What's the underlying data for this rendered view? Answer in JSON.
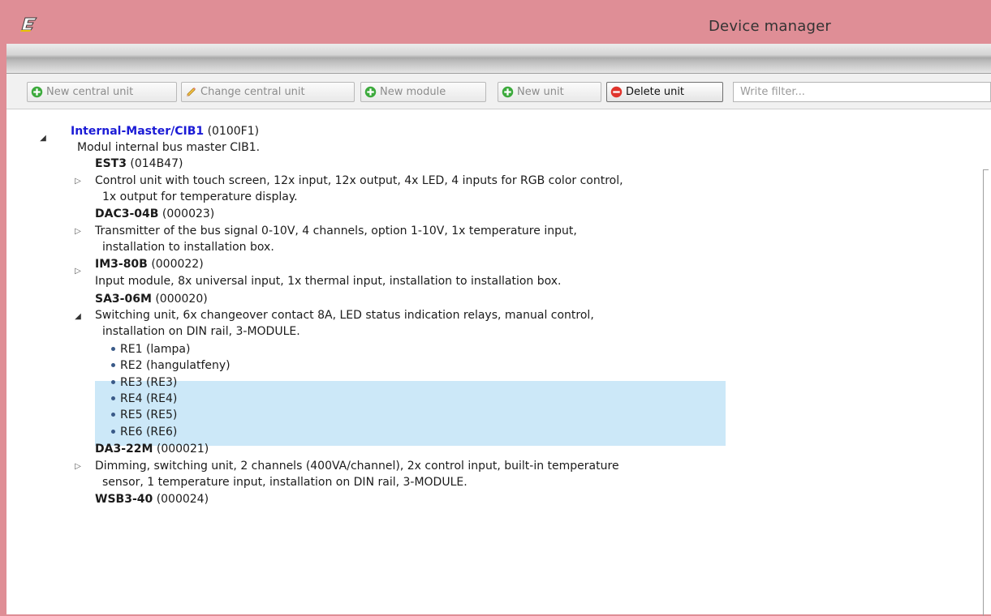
{
  "window": {
    "title": "Device manager",
    "logo": "app-logo-icon"
  },
  "toolbar": {
    "new_central_unit": "New central unit",
    "change_central_unit": "Change central unit",
    "new_module": "New module",
    "new_unit": "New unit",
    "delete_unit": "Delete unit",
    "filter_placeholder": "Write filter..."
  },
  "tree": {
    "root": {
      "name": "Internal-Master/CIB1",
      "code": "(0100F1)",
      "description": "Modul internal bus master CIB1."
    },
    "modules": [
      {
        "name": "EST3",
        "code": "(014B47)",
        "description": [
          "Control unit with touch screen, 12x input, 12x output, 4x LED, 4 inputs for RGB color control,",
          "1x output for temperature display."
        ]
      },
      {
        "name": "DAC3-04B",
        "code": "(000023)",
        "description": [
          "Transmitter of the bus signal 0-10V, 4 channels, option 1-10V, 1x temperature input,",
          "installation to installation box."
        ]
      },
      {
        "name": "IM3-80B",
        "code": "(000022)",
        "description": [
          "Input module, 8x universal input, 1x thermal input, installation to installation box."
        ]
      },
      {
        "name": "SA3-06M",
        "code": "(000020)",
        "description": [
          "Switching unit, 6x changeover contact 8A, LED status indication relays, manual control,",
          "installation on DIN rail, 3-MODULE."
        ],
        "children": [
          {
            "name": "RE1",
            "alias": "(lampa)"
          },
          {
            "name": "RE2",
            "alias": "(hangulatfeny)"
          },
          {
            "name": "RE3",
            "alias": "(RE3)"
          },
          {
            "name": "RE4",
            "alias": "(RE4)"
          },
          {
            "name": "RE5",
            "alias": "(RE5)"
          },
          {
            "name": "RE6",
            "alias": "(RE6)"
          }
        ]
      },
      {
        "name": "DA3-22M",
        "code": "(000021)",
        "description": [
          "Dimming, switching unit, 2 channels (400VA/channel), 2x control input, built-in temperature",
          "sensor, 1 temperature input, installation on DIN rail, 3-MODULE."
        ]
      },
      {
        "name": "WSB3-40",
        "code": "(000024)"
      }
    ]
  },
  "colors": {
    "titlebar": "#df8e96",
    "selection": "#cce8f8",
    "root_link": "#1b1bd6",
    "add_icon": "#3caa3c",
    "delete_icon": "#e0342c"
  },
  "icons": {
    "add": "plus-circle-icon",
    "edit": "pencil-icon",
    "delete": "minus-circle-icon",
    "collapsed": "triangle-right-icon",
    "expanded": "triangle-down-icon",
    "leaf": "bullet-icon"
  }
}
